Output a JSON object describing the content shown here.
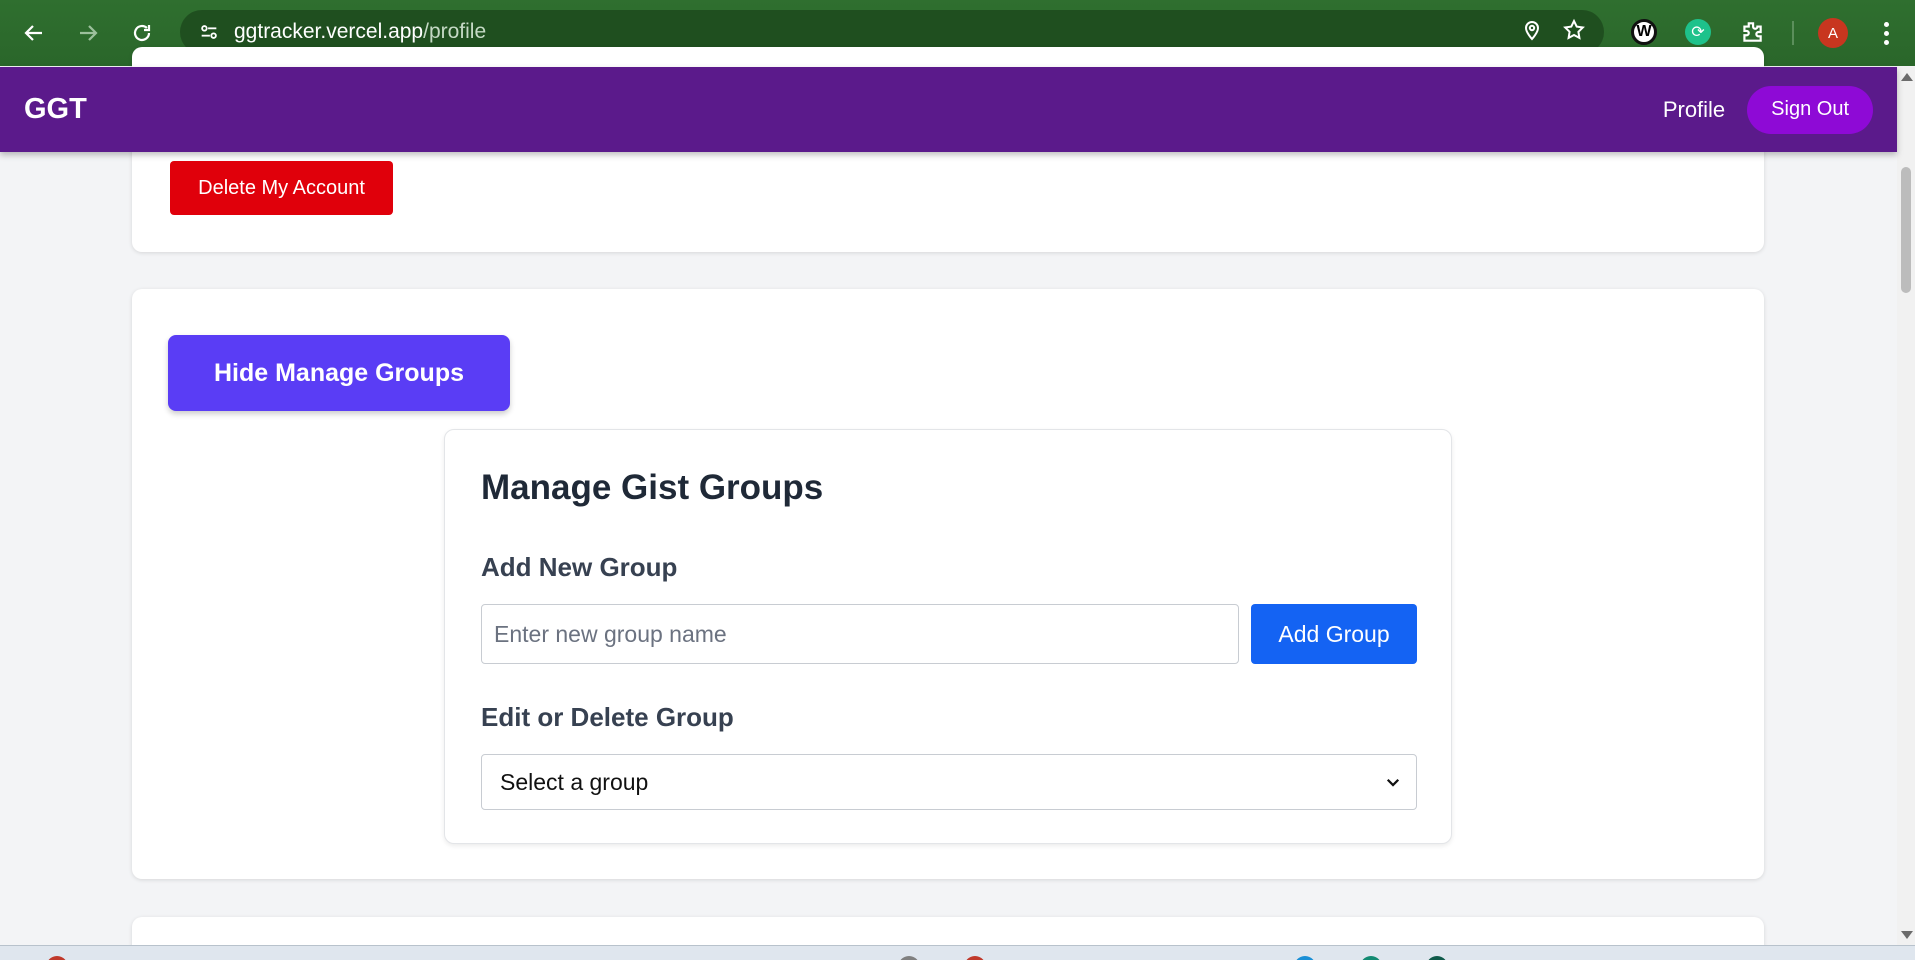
{
  "browser": {
    "url_host": "ggtracker.vercel.app",
    "url_path": "/profile",
    "avatar_letter": "A",
    "extension_w_letter": "W"
  },
  "app": {
    "brand": "GGT",
    "nav_profile": "Profile",
    "nav_signout": "Sign Out"
  },
  "account": {
    "delete_label": "Delete My Account"
  },
  "groups": {
    "toggle_label": "Hide Manage Groups",
    "title": "Manage Gist Groups",
    "add_heading": "Add New Group",
    "input_placeholder": "Enter new group name",
    "input_value": "",
    "add_button": "Add Group",
    "edit_heading": "Edit or Delete Group",
    "select_value": "Select a group"
  },
  "colors": {
    "navbar": "#5b1a8b",
    "signout": "#8e0ad6",
    "delete": "#e0000b",
    "toggle": "#5a3df5",
    "add": "#1463f3"
  }
}
